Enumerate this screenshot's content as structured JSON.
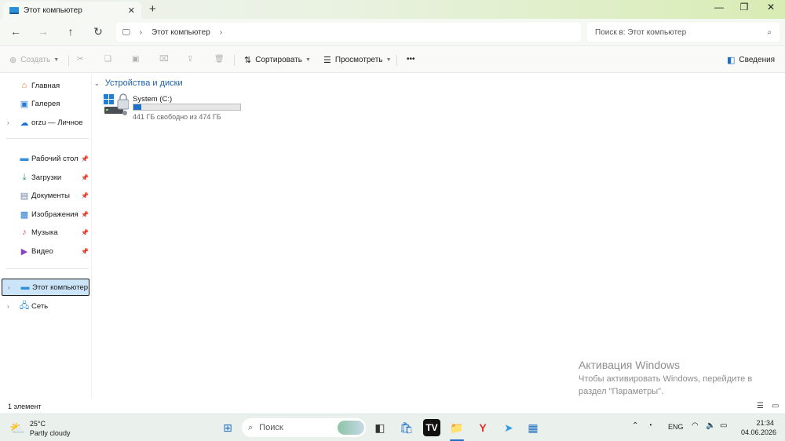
{
  "window": {
    "tab_title": "Этот компьютер"
  },
  "address": {
    "path": "Этот компьютер",
    "search_placeholder": "Поиск в: Этот компьютер"
  },
  "toolbar": {
    "create": "Создать",
    "sort": "Сортировать",
    "view": "Просмотреть",
    "more": "•••",
    "details": "Сведения"
  },
  "sidebar": {
    "home": "Главная",
    "gallery": "Галерея",
    "onedrive": "orzu — Личное",
    "desktop": "Рабочий стол",
    "downloads": "Загрузки",
    "documents": "Документы",
    "images": "Изображения",
    "music": "Музыка",
    "video": "Видео",
    "this_pc": "Этот компьютер",
    "network": "Сеть"
  },
  "content": {
    "section": "Устройства и диски",
    "drive": {
      "name": "System (C:)",
      "free": "441 ГБ свободно из 474 ГБ",
      "used_fraction": 0.07
    }
  },
  "status": {
    "count": "1 элемент"
  },
  "activation": {
    "title": "Активация Windows",
    "line1": "Чтобы активировать Windows, перейдите в",
    "line2": "раздел \"Параметры\"."
  },
  "taskbar": {
    "temp": "25°C",
    "weather": "Partly cloudy",
    "search": "Поиск",
    "lang": "ENG",
    "time": "21:34",
    "date": "04.06.2026"
  }
}
